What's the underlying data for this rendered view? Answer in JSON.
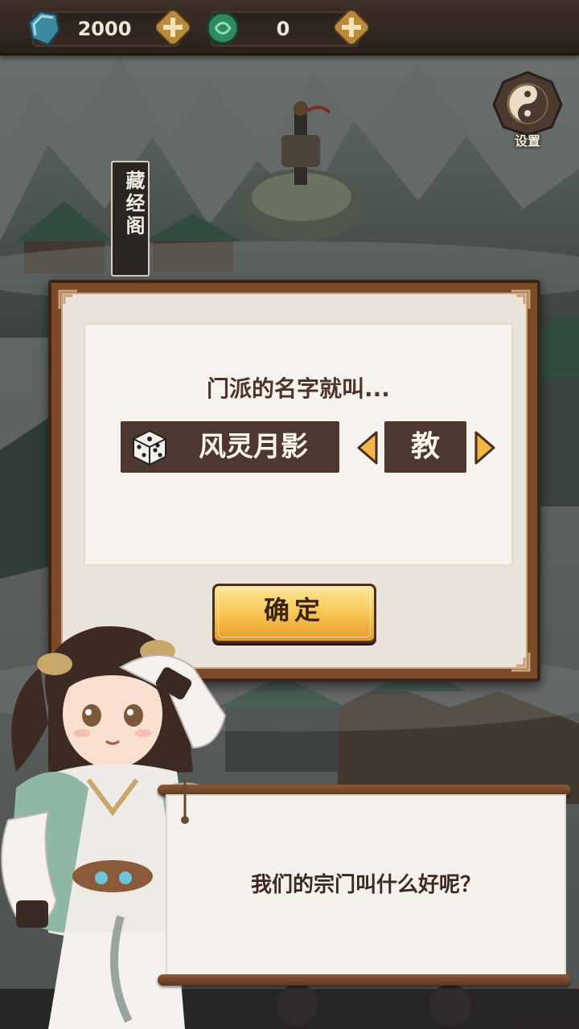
{
  "currencies": [
    {
      "icon": "jade-gem-icon",
      "value": "2000"
    },
    {
      "icon": "jade-coin-icon",
      "value": "0"
    }
  ],
  "settings": {
    "label": "设置"
  },
  "map": {
    "banner_label": "藏经阁"
  },
  "dialog": {
    "prompt": "门派的名字就叫...",
    "sect_name": "风灵月影",
    "sect_suffix": "教",
    "confirm_label": "确定"
  },
  "speech": {
    "text": "我们的宗门叫什么好呢？"
  },
  "colors": {
    "accent_gold": "#f7c24d",
    "dark_box": "#4d3830",
    "frame_brown": "#7a4a2a",
    "panel_bg": "#f6f3ef"
  }
}
